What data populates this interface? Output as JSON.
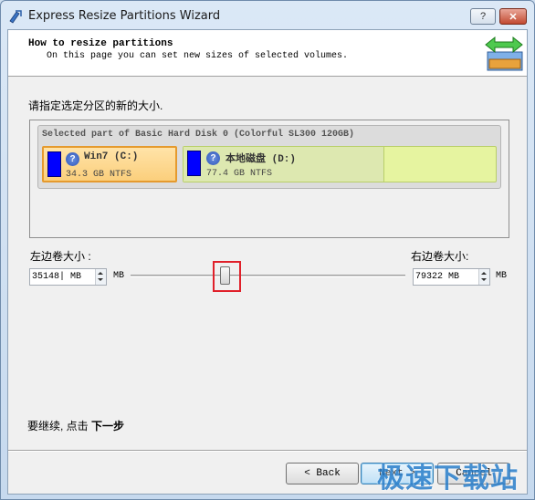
{
  "window": {
    "title": "Express Resize Partitions Wizard",
    "help_label": "?",
    "close_label": "✕"
  },
  "header": {
    "title": "How to resize partitions",
    "subtitle": "On this page you can set new sizes of selected volumes."
  },
  "prompt": "请指定选定分区的新的大小.",
  "disk": {
    "label": "Selected part of Basic Hard Disk 0 (Colorful SL300 120GB)",
    "partitions": [
      {
        "name": "Win7 (C:)",
        "size": "34.3 GB NTFS",
        "icon": "question-icon"
      },
      {
        "name": "本地磁盘 (D:)",
        "size": "77.4 GB NTFS",
        "icon": "question-icon"
      }
    ]
  },
  "left_volume": {
    "label": "左边卷大小 :",
    "value": "35148",
    "field_unit": "MB",
    "unit": "MB"
  },
  "right_volume": {
    "label": "右边卷大小:",
    "value": "79322",
    "field_unit": "MB",
    "unit": "MB"
  },
  "slider": {
    "position_fraction": 0.34
  },
  "footer": {
    "continue_text": "要继续, 点击 ",
    "continue_bold": "下一步"
  },
  "buttons": {
    "back": "< Back",
    "next": "Next >",
    "cancel": "Cancel"
  },
  "watermark": "极速下载站",
  "colors": {
    "accent_highlight": "#e0202a",
    "partition_c": "#fbcf7c",
    "partition_d": "#e6f4a0",
    "partition_bar": "#0000ff"
  }
}
